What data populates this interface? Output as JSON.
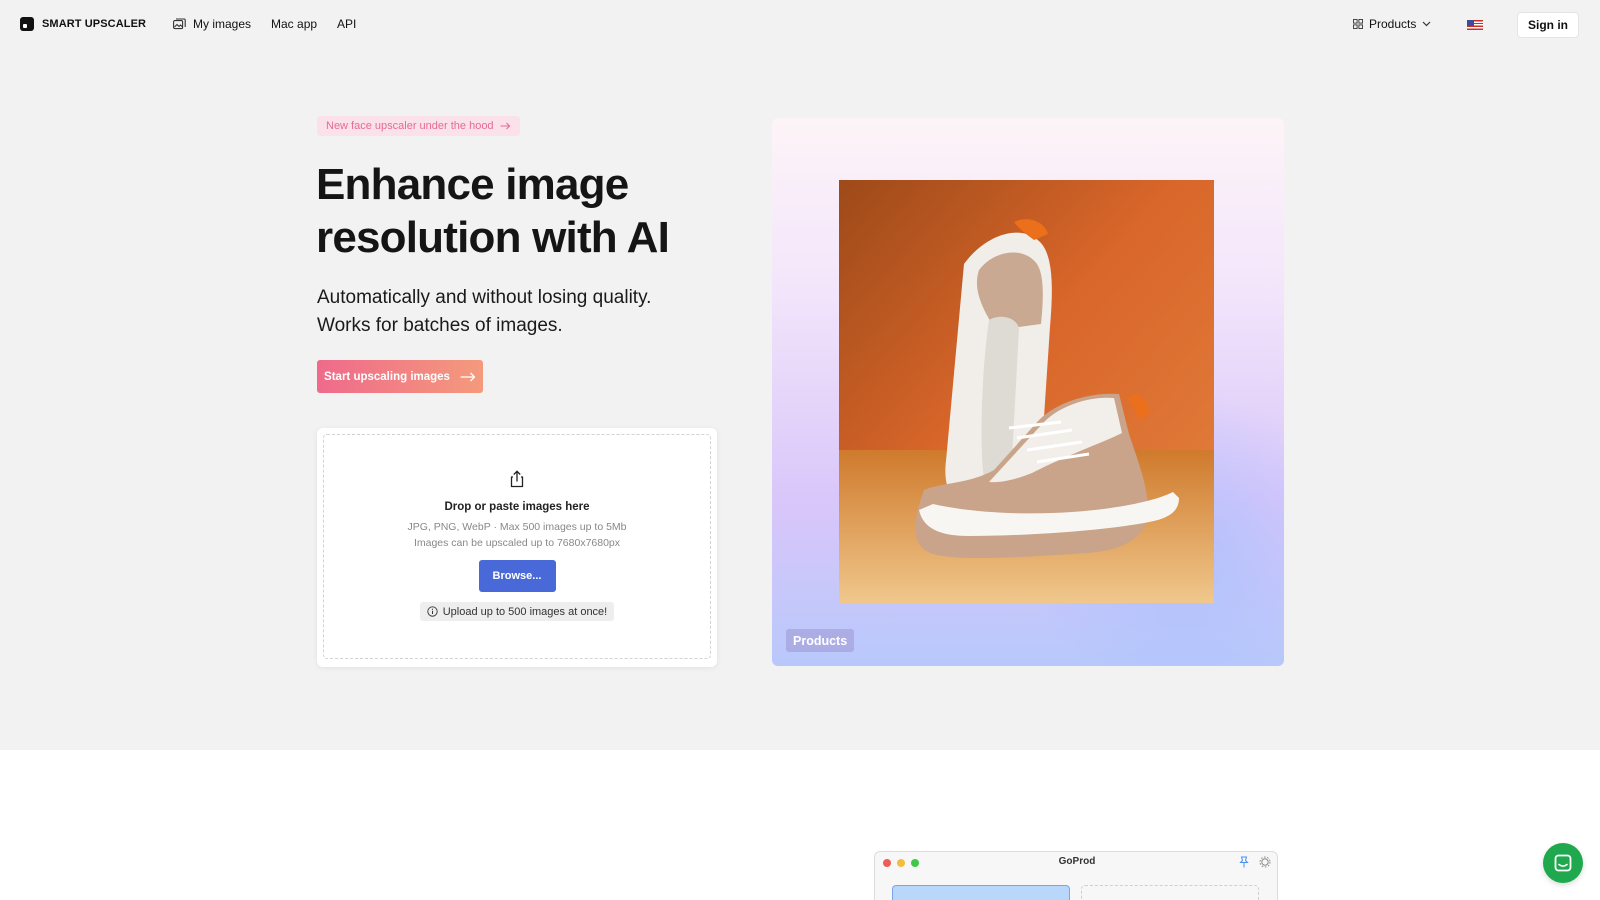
{
  "header": {
    "brand": "SMART UPSCALER",
    "nav": [
      {
        "label": "My images",
        "icon": "image-gallery-icon"
      },
      {
        "label": "Mac app"
      },
      {
        "label": "API"
      }
    ],
    "products_label": "Products",
    "language_flag": "us-flag",
    "signin_label": "Sign in"
  },
  "hero": {
    "badge": "New face upscaler under the hood",
    "title": "Enhance image resolution with AI",
    "subtitle_line1": "Automatically and without losing quality.",
    "subtitle_line2": "Works for batches of images.",
    "cta_label": "Start upscaling images"
  },
  "dropzone": {
    "title": "Drop or paste images here",
    "info_line1": "JPG, PNG, WebP · Max 500 images up to 5Mb",
    "info_line2": "Images can be upscaled up to 7680x7680px",
    "browse_label": "Browse...",
    "note": "Upload up to 500 images at once!"
  },
  "showcase": {
    "category_label": "Products",
    "image_subject": "sneakers-on-orange-background"
  },
  "mac_window": {
    "title": "GoProd"
  },
  "colors": {
    "accent_gradient_start": "#ef6a8b",
    "accent_gradient_end": "#f49a7c",
    "browse_blue": "#4969d8",
    "chat_green": "#1fa84d"
  }
}
